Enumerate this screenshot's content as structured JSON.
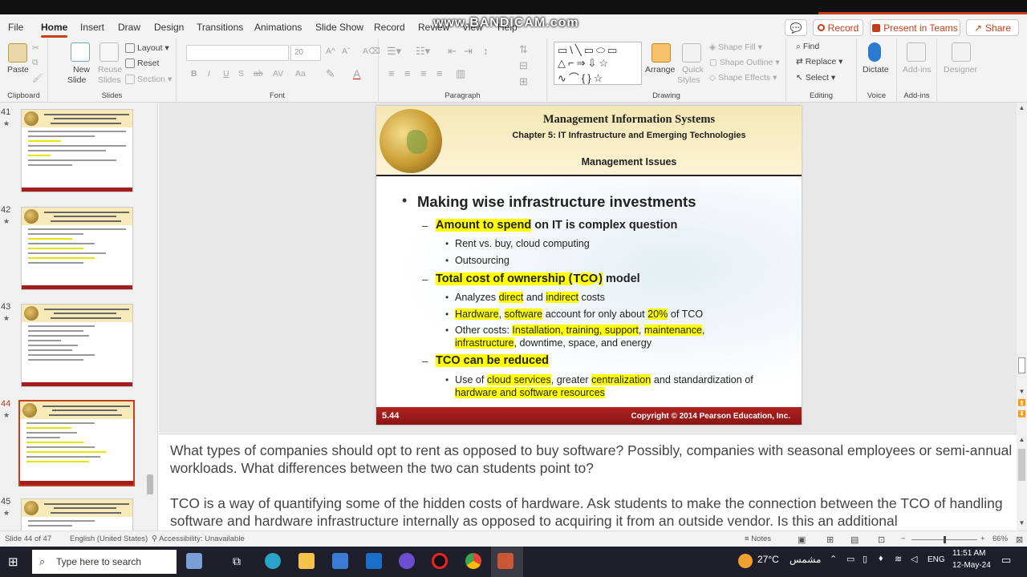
{
  "recorder": {
    "watermark": "www.BANDICAM.com"
  },
  "tabs": [
    "File",
    "Home",
    "Insert",
    "Draw",
    "Design",
    "Transitions",
    "Animations",
    "Slide Show",
    "Record",
    "Review",
    "View",
    "Help"
  ],
  "active_tab": "Home",
  "top_buttons": {
    "comment": "💬",
    "record": "Record",
    "present": "Present in Teams",
    "share": "Share"
  },
  "ribbon": {
    "clipboard": {
      "paste": "Paste",
      "label": "Clipboard"
    },
    "slides": {
      "new_slide": "New",
      "new_slide2": "Slide",
      "reuse": "Reuse",
      "reuse2": "Slides",
      "layout": "Layout",
      "reset": "Reset",
      "section": "Section",
      "label": "Slides"
    },
    "font": {
      "font_name": "",
      "font_size": "20",
      "bold": "B",
      "italic": "I",
      "underline": "U",
      "strike": "S",
      "shadow": "ab",
      "spacing": "AV",
      "case": "Aa",
      "label": "Font"
    },
    "paragraph": {
      "label": "Paragraph"
    },
    "drawing": {
      "arrange": "Arrange",
      "quick": "Quick",
      "quick2": "Styles",
      "shape_fill": "Shape Fill",
      "shape_outline": "Shape Outline",
      "shape_effects": "Shape Effects",
      "label": "Drawing"
    },
    "editing": {
      "find": "Find",
      "replace": "Replace",
      "select": "Select",
      "label": "Editing"
    },
    "voice": {
      "dictate": "Dictate",
      "label": "Voice"
    },
    "addins": {
      "addins": "Add-ins",
      "designer": "Designer",
      "label": "Add-ins"
    }
  },
  "thumbnails": [
    {
      "num": "41"
    },
    {
      "num": "42"
    },
    {
      "num": "43"
    },
    {
      "num": "44"
    },
    {
      "num": "45"
    }
  ],
  "slide": {
    "title": "Management Information Systems",
    "chapter": "Chapter 5: IT Infrastructure and Emerging Technologies",
    "section": "Management Issues",
    "bullet1": "Making wise infrastructure investments",
    "a_hl": "Amount to spend",
    "a_rest": " on IT is complex question",
    "a1": "Rent vs. buy, cloud computing",
    "a2": "Outsourcing",
    "b_hl1": "Total cost of ownership (",
    "b_hl2": "TCO",
    "b_hl3": ")",
    "b_rest": " model",
    "b1_pre": "Analyzes ",
    "b1_h1": "direct",
    "b1_mid": " and ",
    "b1_h2": "indirect",
    "b1_post": " costs",
    "b2_h1": "Hardware",
    "b2_c": ", ",
    "b2_h2": "software",
    "b2_mid": " account for only about ",
    "b2_h3": "20%",
    "b2_post": " of TCO",
    "b3_pre": "Other costs: ",
    "b3_h1": "Installation, training, support",
    "b3_c": ", ",
    "b3_h2": "maintenance",
    "b3_post": ",",
    "b3_l2_h": "infrastructure",
    "b3_l2_post": ", downtime, space, and energy",
    "c_hl": "TCO can be reduced",
    "c1_pre": "Use of ",
    "c1_h1": "cloud services",
    "c1_mid": ", greater ",
    "c1_h2": "centralization",
    "c1_post": " and standardization of",
    "c1_l2": "hardware and software resources",
    "number": "5.44",
    "copyright": "Copyright © 2014 Pearson Education, Inc."
  },
  "notes": {
    "p1": "What types of companies should opt to rent as opposed to buy software? Possibly, companies with seasonal employees or semi-annual workloads. What differences between the two can students point to?",
    "p2": "TCO is a way of quantifying some of the hidden costs of hardware. Ask students to make the connection between the TCO of handling software and hardware infrastructure internally as opposed to acquiring it from an outside vendor. Is this an additional"
  },
  "status": {
    "slide": "Slide 44 of 47",
    "lang": "English (United States)",
    "access": "Accessibility: Unavailable",
    "notes": "Notes",
    "zoom": "66%"
  },
  "taskbar": {
    "search": "Type here to search",
    "temp": "27°C",
    "weather": "مشمس",
    "lang": "ENG",
    "time": "11:51 AM",
    "date": "12-May-24"
  }
}
